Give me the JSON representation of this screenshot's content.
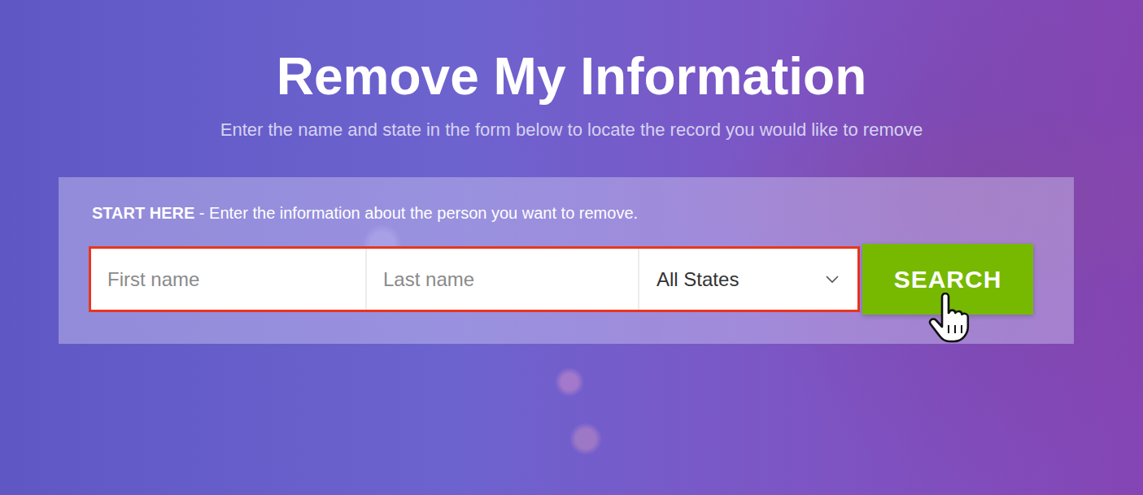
{
  "page": {
    "title": "Remove My Information",
    "subtitle": "Enter the name and state in the form below to locate the record you would like to remove"
  },
  "form": {
    "lead_bold": "START HERE",
    "lead_text": " - Enter the information about the person you want to remove.",
    "fields": [
      {
        "placeholder": "First name"
      },
      {
        "placeholder": "Last name"
      }
    ],
    "state_select": {
      "value": "All States"
    },
    "highlighted": true,
    "button": "SEARCH"
  }
}
